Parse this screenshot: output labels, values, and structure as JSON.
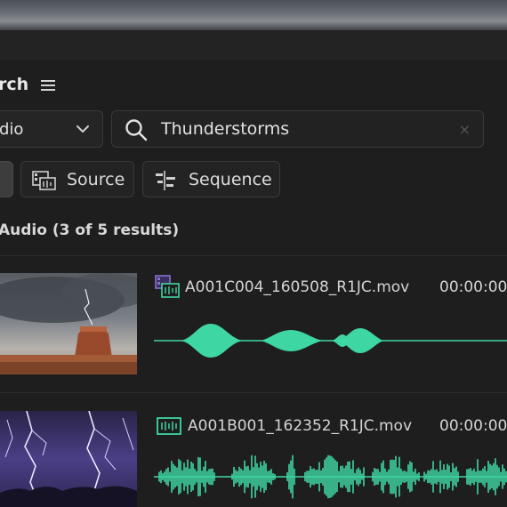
{
  "panel": {
    "title": "rch"
  },
  "filter": {
    "dropdown_value": "dio"
  },
  "search": {
    "value": "Thunderstorms",
    "clear_glyph": "×"
  },
  "chips": {
    "source_label": "Source",
    "sequence_label": "Sequence"
  },
  "results": {
    "label": "Audio (3 of 5 results)"
  },
  "items": [
    {
      "filename": "A001C004_160508_R1JC.mov",
      "timecode": "00:00:00",
      "icon": "multi-clip-audio-icon"
    },
    {
      "filename": "A001B001_162352_R1JC.mov",
      "timecode": "00:00:00",
      "icon": "audio-clip-icon"
    }
  ],
  "colors": {
    "waveform": "#3ed6a3",
    "background": "#1e1e1e",
    "icon_purple": "#8a6fd6"
  }
}
